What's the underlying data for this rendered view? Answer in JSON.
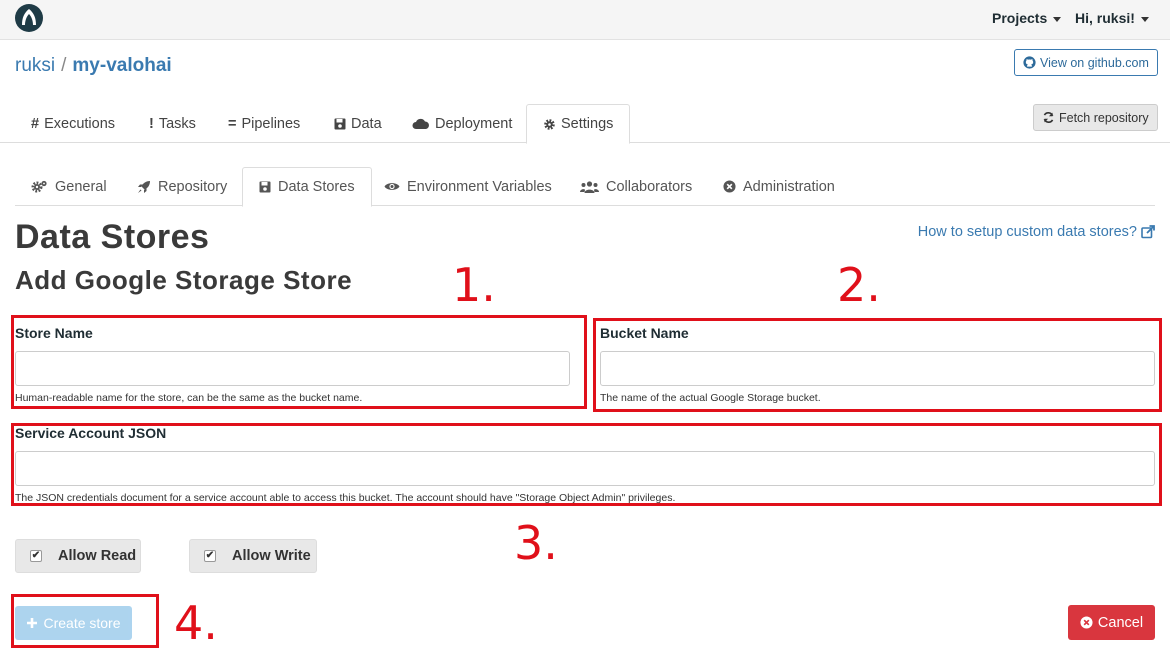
{
  "nav": {
    "projects": "Projects",
    "user": "Hi, ruksi!"
  },
  "breadcrumb": {
    "owner": "ruksi",
    "separator": "/",
    "project": "my-valohai"
  },
  "actions": {
    "github": "View on github.com",
    "fetch": "Fetch repository"
  },
  "main_tabs": [
    {
      "label": "Executions",
      "icon": "hash-icon"
    },
    {
      "label": "Tasks",
      "icon": "exclamation-icon"
    },
    {
      "label": "Pipelines",
      "icon": "equals-icon"
    },
    {
      "label": "Data",
      "icon": "floppy-icon"
    },
    {
      "label": "Deployment",
      "icon": "cloud-icon"
    },
    {
      "label": "Settings",
      "icon": "gear-icon",
      "active": true
    }
  ],
  "sub_tabs": [
    {
      "label": "General",
      "icon": "gears-icon"
    },
    {
      "label": "Repository",
      "icon": "rocket-icon"
    },
    {
      "label": "Data Stores",
      "icon": "floppy-icon",
      "active": true
    },
    {
      "label": "Environment Variables",
      "icon": "eye-icon"
    },
    {
      "label": "Collaborators",
      "icon": "users-icon"
    },
    {
      "label": "Administration",
      "icon": "times-circle-icon"
    }
  ],
  "page": {
    "title": "Data Stores",
    "subtitle": "Add Google Storage Store",
    "help_link": "How to setup custom data stores?"
  },
  "form": {
    "store_name": {
      "label": "Store Name",
      "value": "",
      "help": "Human-readable name for the store, can be the same as the bucket name."
    },
    "bucket_name": {
      "label": "Bucket Name",
      "value": "",
      "help": "The name of the actual Google Storage bucket."
    },
    "service_account": {
      "label": "Service Account JSON",
      "value": "",
      "help": "The JSON credentials document for a service account able to access this bucket. The account should have \"Storage Object Admin\" privileges."
    },
    "allow_read": {
      "label": "Allow Read",
      "checked": true
    },
    "allow_write": {
      "label": "Allow Write",
      "checked": true
    },
    "create": "Create store",
    "cancel": "Cancel"
  },
  "annotations": [
    "1.",
    "2.",
    "3.",
    "4."
  ],
  "colors": {
    "accent": "#3a7ab0",
    "annotation": "#e0101a",
    "danger": "#d9363e",
    "primary_disabled": "#a9d2ee"
  }
}
